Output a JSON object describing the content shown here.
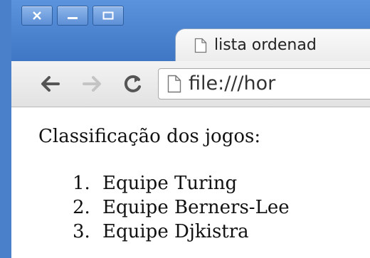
{
  "window": {
    "controls": [
      "close",
      "minimize",
      "maximize"
    ],
    "frame_color": "#4a7fc9"
  },
  "tab": {
    "title": "lista ordenad",
    "icon": "page-icon"
  },
  "toolbar": {
    "back_icon": "arrow-left-icon",
    "forward_icon": "arrow-right-icon",
    "reload_icon": "reload-icon",
    "url": "file:///hor"
  },
  "content": {
    "heading": "Classificação dos jogos:",
    "list": [
      {
        "number": "1.",
        "label": "Equipe Turing"
      },
      {
        "number": "2.",
        "label": "Equipe Berners-Lee"
      },
      {
        "number": "3.",
        "label": "Equipe Djkistra"
      }
    ]
  }
}
